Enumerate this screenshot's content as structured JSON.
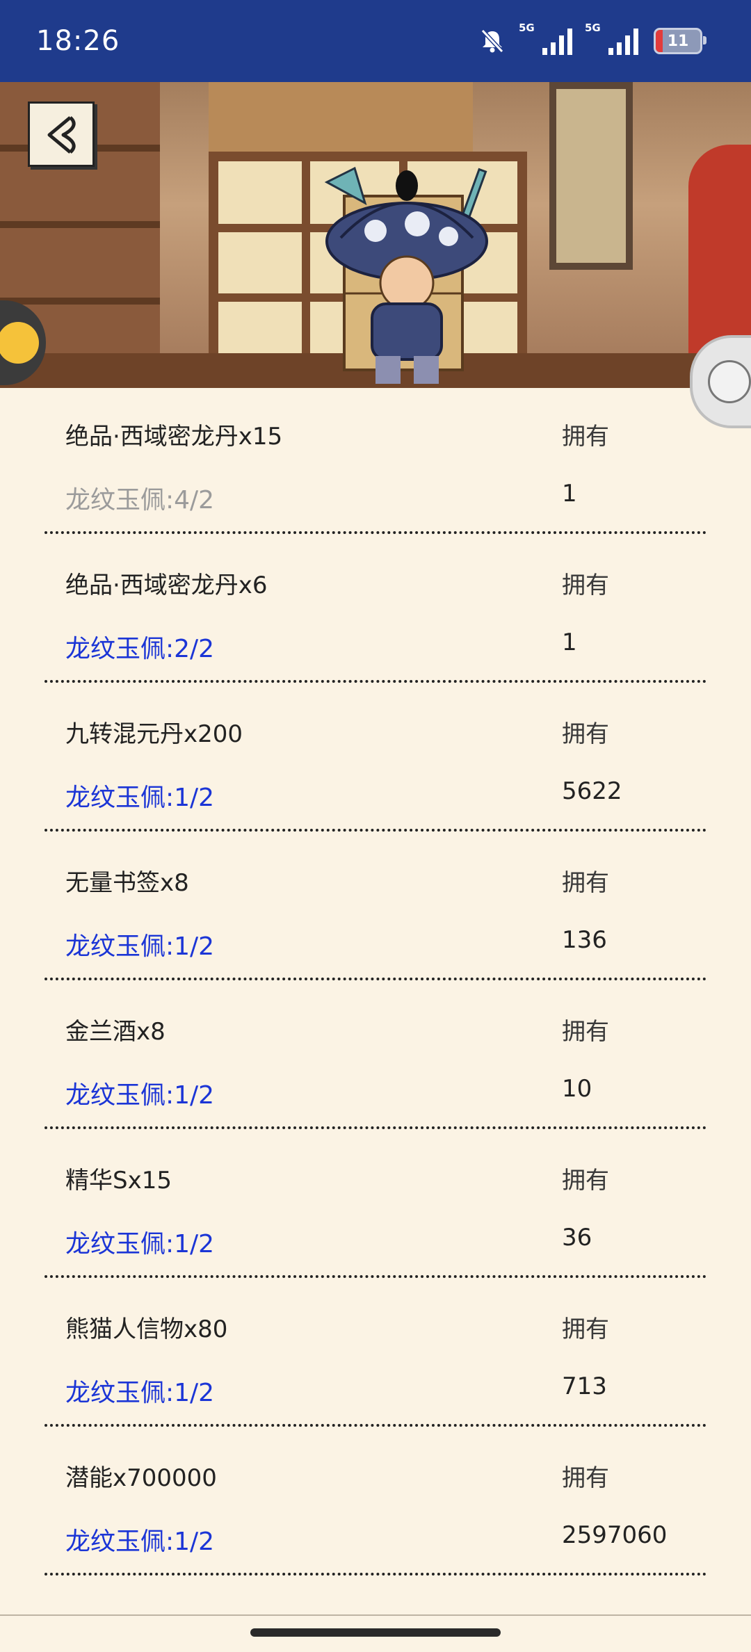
{
  "status_bar": {
    "time": "18:26",
    "signal1_label": "5G",
    "signal2_label": "5G",
    "battery": "11",
    "icons": [
      "bell-muted-icon",
      "signal-icon",
      "signal-icon",
      "battery-icon"
    ]
  },
  "header": {
    "back_icon": "back-arrow-icon"
  },
  "items": [
    {
      "name": "绝品·西域密龙丹x15",
      "requirement": "龙纹玉佩:4/2",
      "own_label": "拥有",
      "own_count": "1"
    },
    {
      "name": "绝品·西域密龙丹x6",
      "requirement": "龙纹玉佩:2/2",
      "own_label": "拥有",
      "own_count": "1"
    },
    {
      "name": "九转混元丹x200",
      "requirement": "龙纹玉佩:1/2",
      "own_label": "拥有",
      "own_count": "5622"
    },
    {
      "name": "无量书签x8",
      "requirement": "龙纹玉佩:1/2",
      "own_label": "拥有",
      "own_count": "136"
    },
    {
      "name": "金兰酒x8",
      "requirement": "龙纹玉佩:1/2",
      "own_label": "拥有",
      "own_count": "10"
    },
    {
      "name": "精华Sx15",
      "requirement": "龙纹玉佩:1/2",
      "own_label": "拥有",
      "own_count": "36"
    },
    {
      "name": "熊猫人信物x80",
      "requirement": "龙纹玉佩:1/2",
      "own_label": "拥有",
      "own_count": "713"
    },
    {
      "name": "潜能x700000",
      "requirement": "龙纹玉佩:1/2",
      "own_label": "拥有",
      "own_count": "2597060"
    }
  ],
  "colors": {
    "status_bar": "#1f3b8c",
    "background": "#fbf3e4",
    "requirement_active": "#1b35d6",
    "requirement_inactive": "#9b9b9b"
  }
}
